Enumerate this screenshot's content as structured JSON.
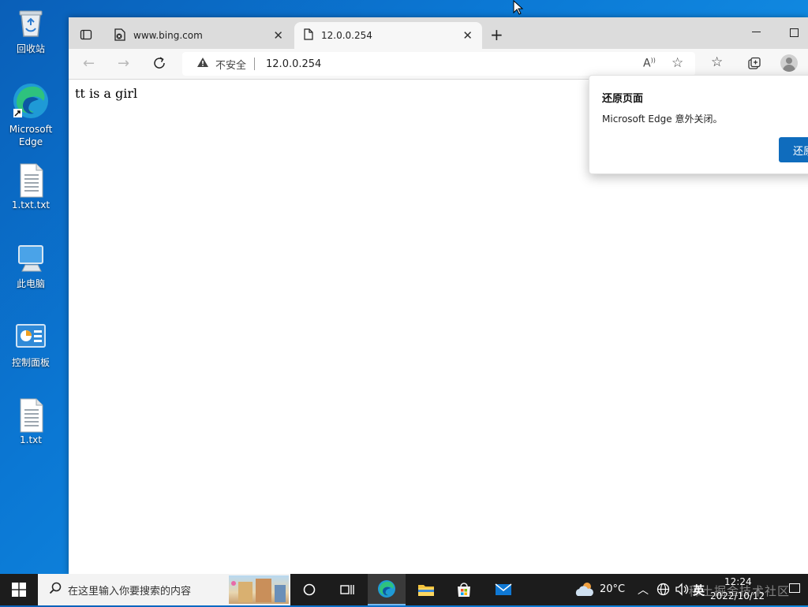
{
  "desktop": {
    "icons": [
      {
        "label": "回收站"
      },
      {
        "label": "Microsoft Edge"
      },
      {
        "label": "1.txt.txt"
      },
      {
        "label": "此电脑"
      },
      {
        "label": "控制面板"
      },
      {
        "label": "1.txt"
      }
    ]
  },
  "browser": {
    "tabs": [
      {
        "title": "www.bing.com"
      },
      {
        "title": "12.0.0.254"
      }
    ],
    "address": {
      "security_label": "不安全",
      "url": "12.0.0.254"
    },
    "page": {
      "text": "tt is a girl"
    },
    "restore_popup": {
      "title": "还原页面",
      "message": "Microsoft Edge 意外关闭。",
      "button_label": "还原"
    }
  },
  "taskbar": {
    "search_placeholder": "在这里输入你要搜索的内容",
    "weather": "20°C",
    "ime": "英",
    "time": "12:24",
    "date": "2022/10/12",
    "watermark": "稀土掘金技术社区"
  },
  "colors": {
    "accent": "#0f6cbd",
    "taskbar": "#1c1c1c",
    "desktop": "#0b78d4"
  }
}
